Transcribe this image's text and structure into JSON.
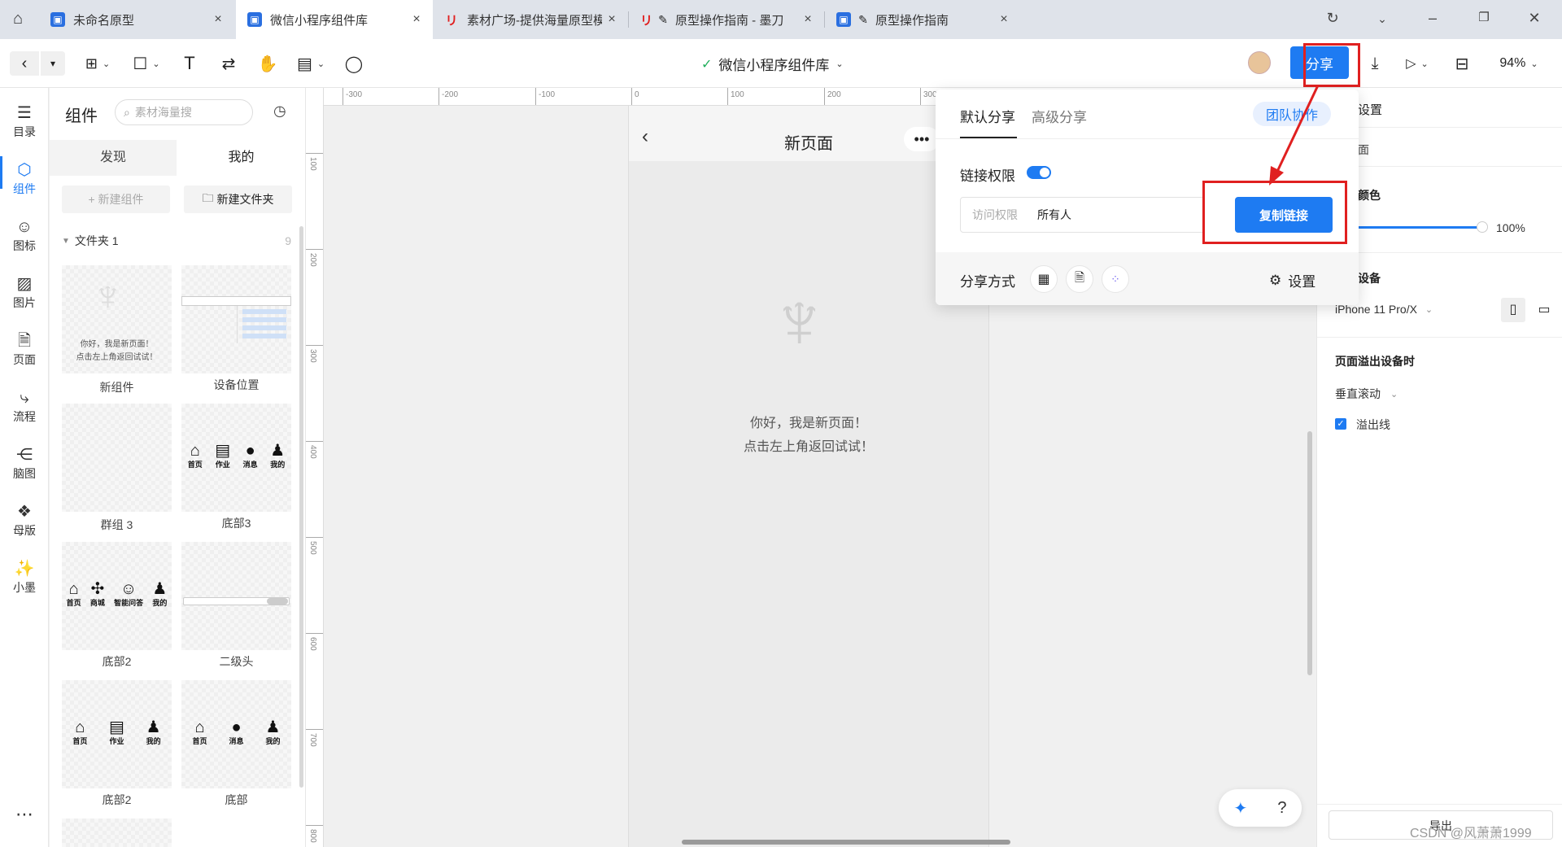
{
  "tabs": [
    {
      "label": "未命名原型",
      "active": false
    },
    {
      "label": "微信小程序组件库",
      "active": true
    },
    {
      "label": "素材广场-提供海量原型模",
      "active": false
    },
    {
      "label": "原型操作指南 - 墨刀",
      "active": false
    },
    {
      "label": "原型操作指南",
      "active": false
    }
  ],
  "toolbar": {
    "doc_title": "微信小程序组件库",
    "share_label": "分享",
    "zoom": "94%"
  },
  "left_nav": [
    {
      "label": "目录",
      "icon": "list-icon"
    },
    {
      "label": "组件",
      "icon": "component-icon"
    },
    {
      "label": "图标",
      "icon": "smile-icon"
    },
    {
      "label": "图片",
      "icon": "image-icon"
    },
    {
      "label": "页面",
      "icon": "page-icon"
    },
    {
      "label": "流程",
      "icon": "flow-icon"
    },
    {
      "label": "脑图",
      "icon": "mindmap-icon"
    },
    {
      "label": "母版",
      "icon": "master-icon"
    },
    {
      "label": "小墨",
      "icon": "magic-wand-icon"
    }
  ],
  "panel": {
    "title": "组件",
    "search_placeholder": "素材海量搜",
    "tab_discover": "发现",
    "tab_mine": "我的",
    "new_component": "+ 新建组件",
    "new_folder": "新建文件夹",
    "folder_name": "文件夹 1",
    "folder_count": "9",
    "cards": [
      {
        "label": "新组件",
        "line1": "你好，我是新页面！",
        "line2": "点击左上角返回试试！"
      },
      {
        "label": "设备位置"
      },
      {
        "label": "群组 3"
      },
      {
        "label": "底部3",
        "items": [
          "首页",
          "作业",
          "消息",
          "我的"
        ]
      },
      {
        "label": "底部2",
        "items": [
          "首页",
          "商城",
          "智能问答",
          "我的"
        ]
      },
      {
        "label": "二级头"
      },
      {
        "label": "底部2",
        "items": [
          "首页",
          "作业",
          "我的"
        ]
      },
      {
        "label": "底部",
        "items": [
          "首页",
          "消息",
          "我的"
        ]
      }
    ]
  },
  "ruler": {
    "h": [
      "-300",
      "-200",
      "-100",
      "0",
      "100",
      "200",
      "300"
    ],
    "v": [
      "100",
      "200",
      "300",
      "400",
      "500",
      "600",
      "700",
      "800"
    ]
  },
  "phone": {
    "title": "新页面",
    "line1": "你好，我是新页面！",
    "line2": "点击左上角返回试试！"
  },
  "popup": {
    "tab_default": "默认分享",
    "tab_advanced": "高级分享",
    "team_label": "团队协作",
    "link_perm_label": "链接权限",
    "access_label": "访问权限",
    "access_value": "所有人",
    "copy_button": "复制链接",
    "share_method_label": "分享方式",
    "settings_label": "设置"
  },
  "right_panel": {
    "settings": "设置",
    "page": "面",
    "color": "颜色",
    "opacity": "100%",
    "device_title": "设备",
    "device_value": "iPhone 11 Pro/X",
    "overflow_title": "页面溢出设备时",
    "scroll_value": "垂直滚动",
    "overflow_line": "溢出线",
    "export_label": "导出"
  },
  "watermark": "CSDN @风萧萧1999",
  "colors": {
    "accent": "#1e7bf2",
    "highlight_box": "#e02020"
  }
}
